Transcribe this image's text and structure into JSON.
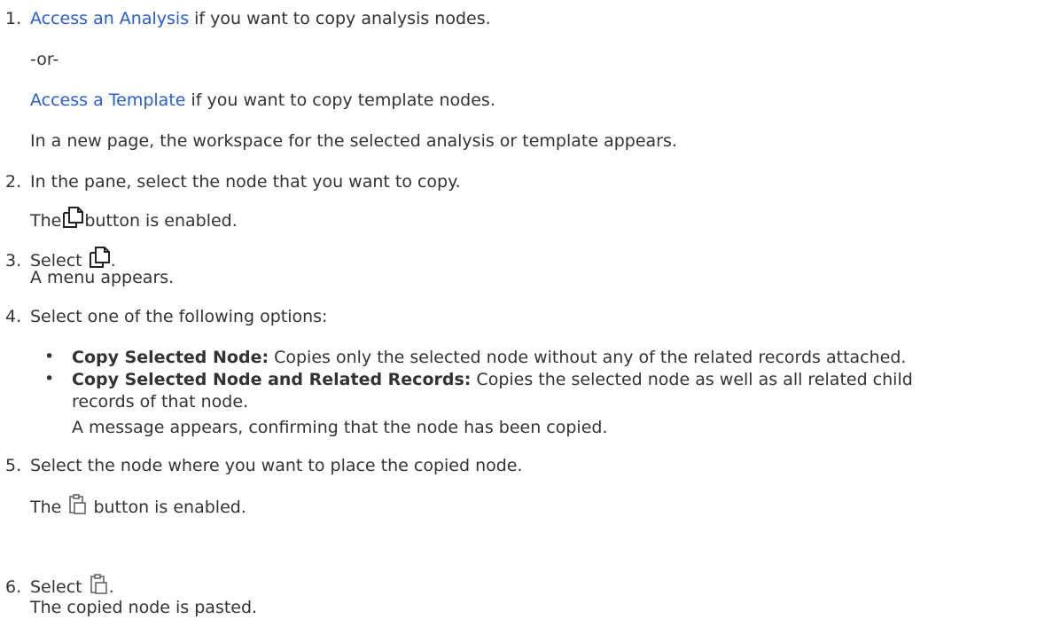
{
  "steps": [
    {
      "number": "1.",
      "link_text": "Access an Analysis",
      "after_link": " if you want to copy analysis nodes.",
      "or_text": "-or-",
      "link2_text": "Access a Template",
      "after_link2": " if you want to copy template nodes.",
      "result": "In a new page, the workspace for the selected analysis or template appears."
    },
    {
      "number": "2.",
      "text": "In the pane, select the node that you want to copy.",
      "result_before": "The",
      "result_after": "button is enabled."
    },
    {
      "number": "3.",
      "text_before": "Select",
      "text_after": ".",
      "result": "A menu appears."
    },
    {
      "number": "4.",
      "text": "Select one of the following options:",
      "options": [
        {
          "bullet": "•",
          "label": "Copy Selected Node:",
          "desc": " Copies only the selected node without any of the related records attached."
        },
        {
          "bullet": "•",
          "label": "Copy Selected Node and Related Records:",
          "desc": " Copies the selected node as well as all related child",
          "desc_cont": "records of that node."
        }
      ],
      "result": "A message appears, confirming that the node has been copied."
    },
    {
      "number": "5.",
      "text": "Select the node where you want to place the copied node.",
      "result_before": "The",
      "result_after": "button is enabled."
    },
    {
      "number": "6.",
      "text_before": "Select",
      "text_after": ".",
      "result": "The copied node is pasted."
    }
  ],
  "icons": {
    "copy": "copy-icon",
    "paste": "paste-icon"
  }
}
